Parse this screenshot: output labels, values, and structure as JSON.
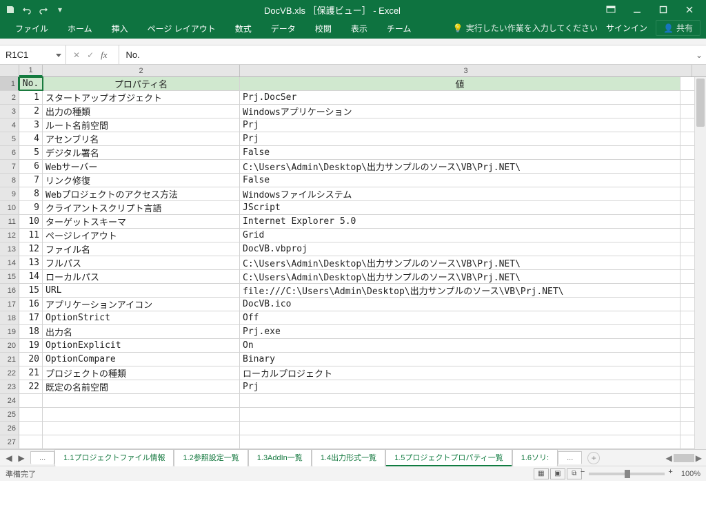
{
  "title": "DocVB.xls ［保護ビュー］ - Excel",
  "ribbon": {
    "tabs": [
      "ファイル",
      "ホーム",
      "挿入",
      "ページ レイアウト",
      "数式",
      "データ",
      "校閲",
      "表示",
      "チーム"
    ],
    "tell_me": "実行したい作業を入力してください",
    "signin": "サインイン",
    "share": "共有"
  },
  "formula_bar": {
    "name_box": "R1C1",
    "fx": "fx",
    "value": "No."
  },
  "columns": {
    "c1": "1",
    "c2": "2",
    "c3": "3"
  },
  "headers": {
    "no": "No.",
    "prop": "プロパティ名",
    "val": "値"
  },
  "rows": [
    {
      "n": "1",
      "prop": "スタートアップオブジェクト",
      "val": "Prj.DocSer"
    },
    {
      "n": "2",
      "prop": "出力の種類",
      "val": "Windowsアプリケーション"
    },
    {
      "n": "3",
      "prop": "ルート名前空間",
      "val": "Prj"
    },
    {
      "n": "4",
      "prop": "アセンブリ名",
      "val": "Prj"
    },
    {
      "n": "5",
      "prop": "デジタル署名",
      "val": "False"
    },
    {
      "n": "6",
      "prop": "Webサーバー",
      "val": "C:\\Users\\Admin\\Desktop\\出力サンプルのソース\\VB\\Prj.NET\\"
    },
    {
      "n": "7",
      "prop": "リンク修復",
      "val": "False"
    },
    {
      "n": "8",
      "prop": "Webプロジェクトのアクセス方法",
      "val": "Windowsファイルシステム"
    },
    {
      "n": "9",
      "prop": "クライアントスクリプト言語",
      "val": "JScript"
    },
    {
      "n": "10",
      "prop": "ターゲットスキーマ",
      "val": "Internet Explorer 5.0"
    },
    {
      "n": "11",
      "prop": "ページレイアウト",
      "val": "Grid"
    },
    {
      "n": "12",
      "prop": "ファイル名",
      "val": "DocVB.vbproj"
    },
    {
      "n": "13",
      "prop": "フルパス",
      "val": "C:\\Users\\Admin\\Desktop\\出力サンプルのソース\\VB\\Prj.NET\\"
    },
    {
      "n": "14",
      "prop": "ローカルパス",
      "val": "C:\\Users\\Admin\\Desktop\\出力サンプルのソース\\VB\\Prj.NET\\"
    },
    {
      "n": "15",
      "prop": "URL",
      "val": "file:///C:\\Users\\Admin\\Desktop\\出力サンプルのソース\\VB\\Prj.NET\\"
    },
    {
      "n": "16",
      "prop": "アプリケーションアイコン",
      "val": "DocVB.ico"
    },
    {
      "n": "17",
      "prop": "OptionStrict",
      "val": "Off"
    },
    {
      "n": "18",
      "prop": "出力名",
      "val": "Prj.exe"
    },
    {
      "n": "19",
      "prop": "OptionExplicit",
      "val": "On"
    },
    {
      "n": "20",
      "prop": "OptionCompare",
      "val": "Binary"
    },
    {
      "n": "21",
      "prop": "プロジェクトの種類",
      "val": "ローカルプロジェクト"
    },
    {
      "n": "22",
      "prop": "既定の名前空間",
      "val": "Prj"
    }
  ],
  "blank_rows": [
    "24",
    "25",
    "26",
    "27"
  ],
  "sheet_tabs": {
    "ellipsis": "...",
    "tabs": [
      {
        "label": "1.1プロジェクトファイル情報",
        "active": false
      },
      {
        "label": "1.2参照設定一覧",
        "active": false
      },
      {
        "label": "1.3AddIn一覧",
        "active": false
      },
      {
        "label": "1.4出力形式一覧",
        "active": false
      },
      {
        "label": "1.5プロジェクトプロパティ一覧",
        "active": true
      },
      {
        "label": "1.6ソリ:",
        "active": false
      }
    ],
    "more": "..."
  },
  "status": {
    "ready": "準備完了",
    "zoom": "100%"
  }
}
